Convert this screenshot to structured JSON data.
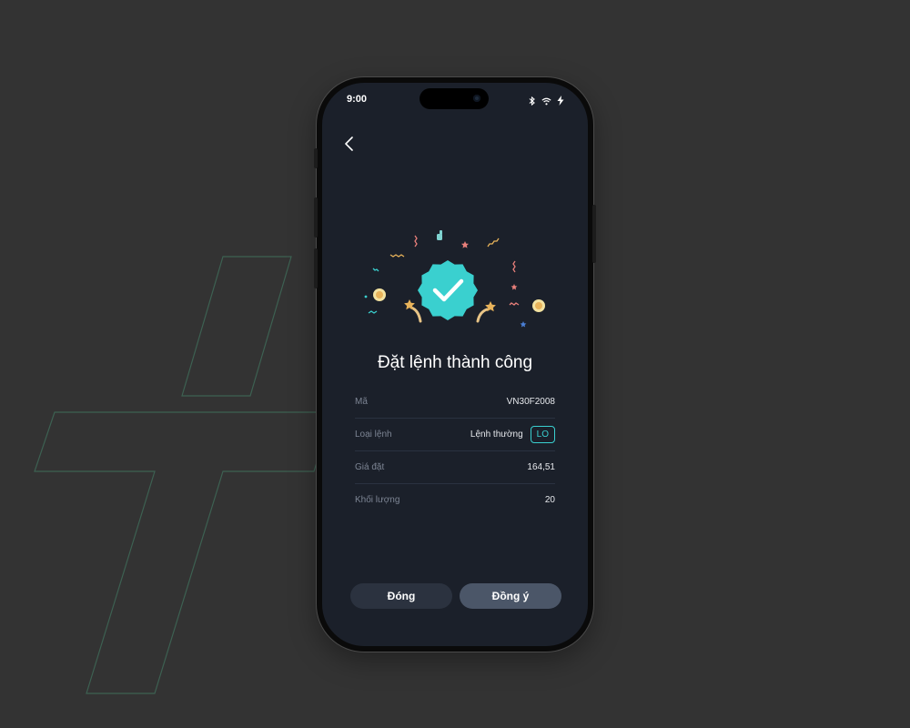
{
  "status_bar": {
    "time": "9:00"
  },
  "dialog": {
    "title": "Đặt lệnh thành công",
    "rows": [
      {
        "label": "Mã",
        "value": "VN30F2008"
      },
      {
        "label": "Loại lệnh",
        "value": "Lệnh thường",
        "tag": "LO"
      },
      {
        "label": "Giá đặt",
        "value": "164,51"
      },
      {
        "label": "Khối lượng",
        "value": "20"
      }
    ]
  },
  "buttons": {
    "close_label": "Đóng",
    "confirm_label": "Đồng ý"
  },
  "colors": {
    "accent": "#3ad0d0",
    "background": "#333333",
    "screen": "#1b202a"
  }
}
